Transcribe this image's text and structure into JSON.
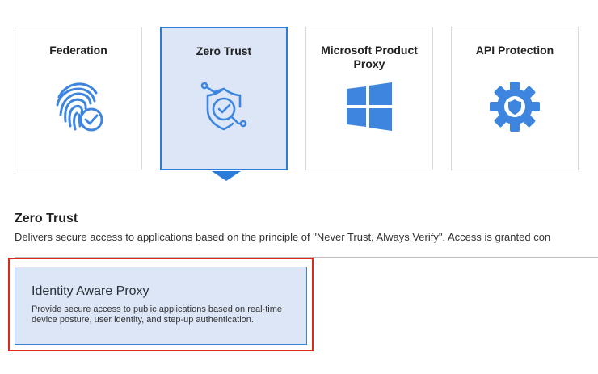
{
  "categories": [
    {
      "id": "federation",
      "title": "Federation",
      "icon": "fingerprint-check-icon",
      "selected": false
    },
    {
      "id": "zero-trust",
      "title": "Zero Trust",
      "icon": "shield-check-network-icon",
      "selected": true
    },
    {
      "id": "microsoft",
      "title": "Microsoft Product Proxy",
      "icon": "windows-logo-icon",
      "selected": false
    },
    {
      "id": "api",
      "title": "API Protection",
      "icon": "gear-shield-icon",
      "selected": false
    }
  ],
  "section": {
    "title": "Zero Trust",
    "description": "Delivers secure access to applications based on the principle of \"Never Trust, Always Verify\". Access is granted con"
  },
  "options": [
    {
      "title": "Identity Aware Proxy",
      "description": "Provide secure access to public applications based on real-time device posture, user identity, and step-up authentication."
    }
  ],
  "colors": {
    "accent": "#2b7bd9",
    "selected_bg": "#dce6f6",
    "icon": "#3d85de",
    "highlight": "#e0271e"
  }
}
